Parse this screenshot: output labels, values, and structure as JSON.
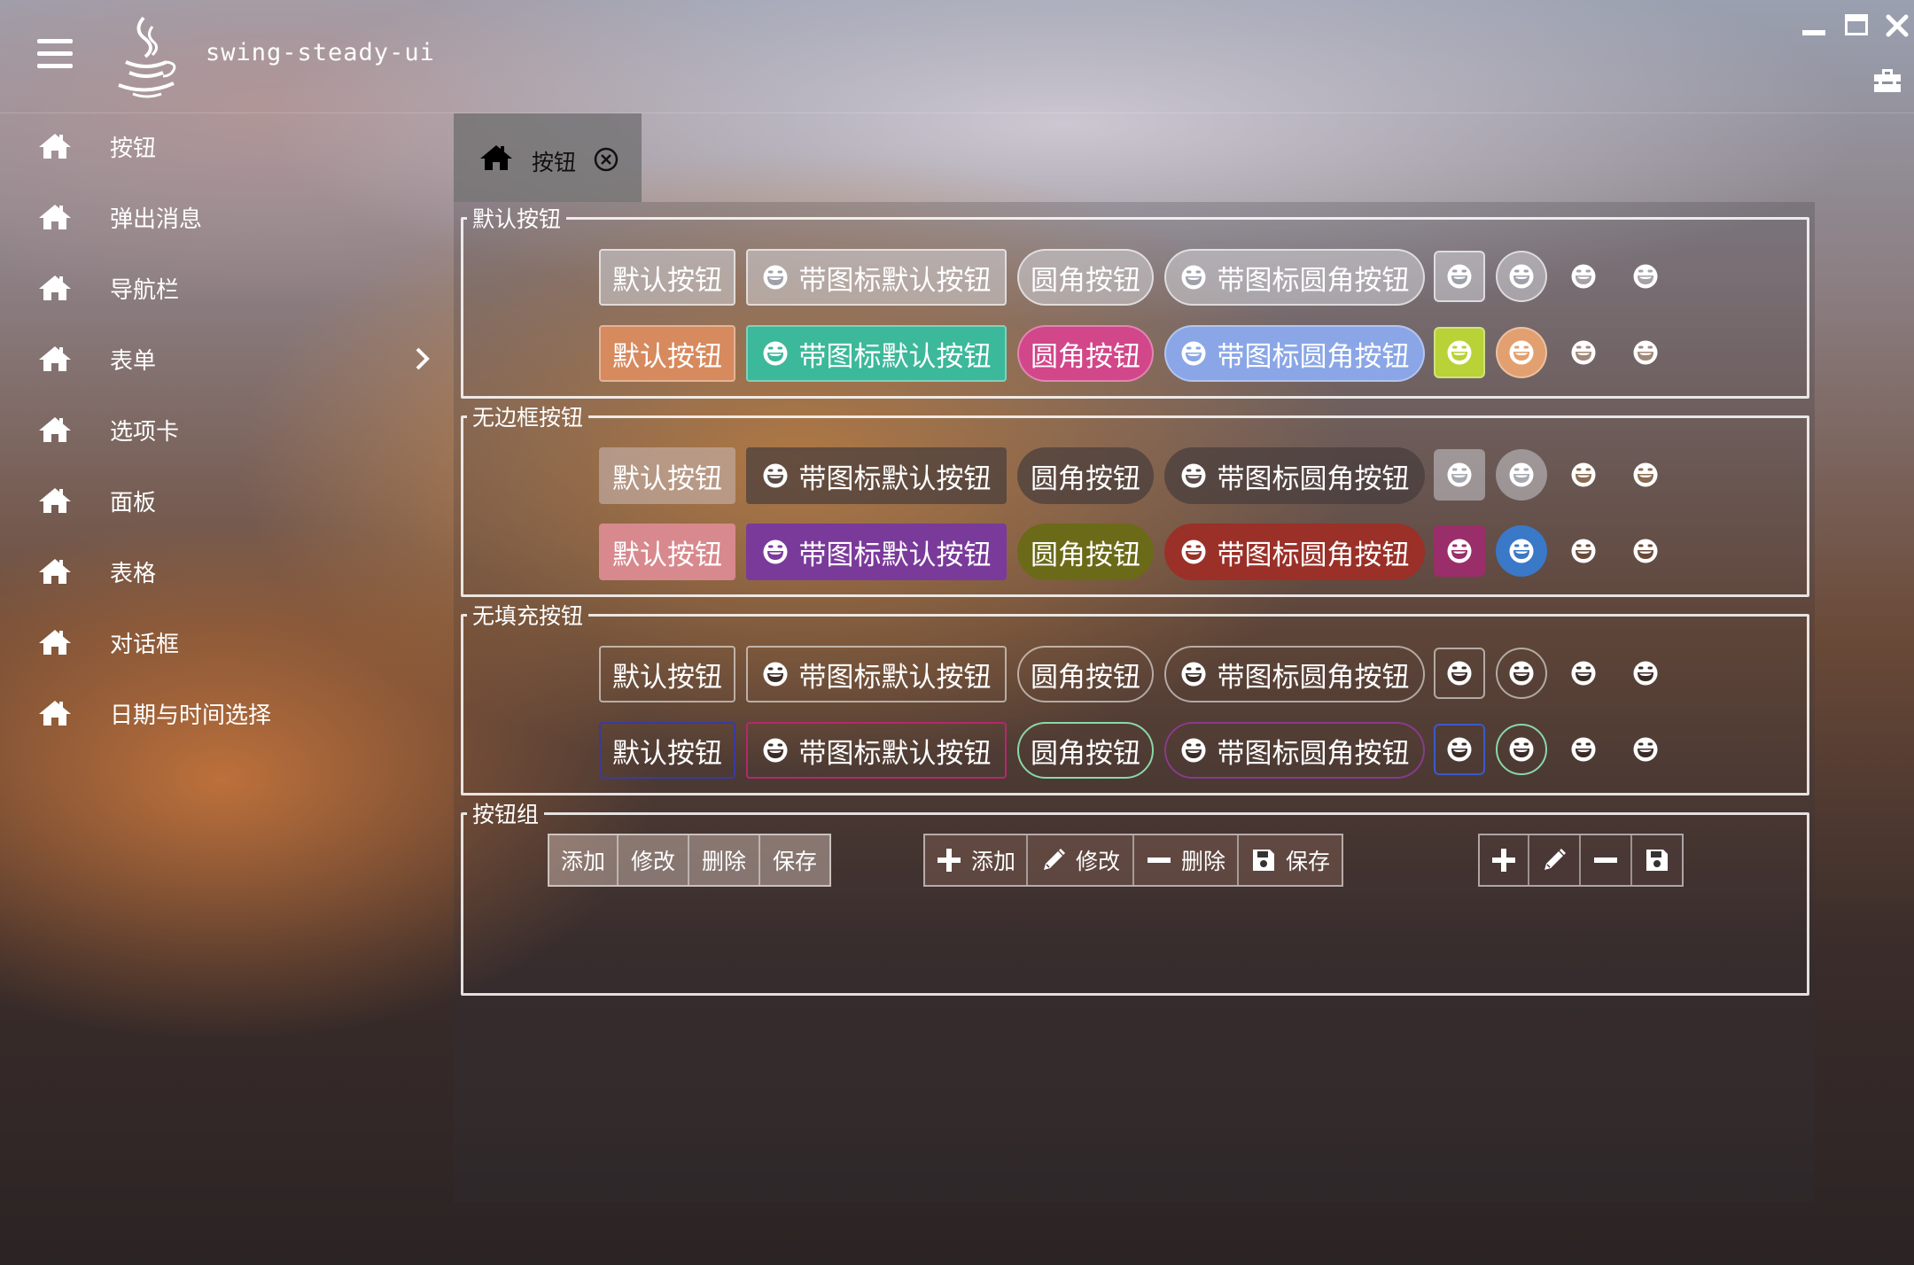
{
  "app": {
    "title": "swing-steady-ui"
  },
  "sidebar": {
    "items": [
      {
        "label": "按钮"
      },
      {
        "label": "弹出消息"
      },
      {
        "label": "导航栏"
      },
      {
        "label": "表单"
      },
      {
        "label": "选项卡"
      },
      {
        "label": "面板"
      },
      {
        "label": "表格"
      },
      {
        "label": "对话框"
      },
      {
        "label": "日期与时间选择"
      }
    ]
  },
  "tabs": [
    {
      "label": "按钮"
    }
  ],
  "sections": {
    "default": {
      "title": "默认按钮"
    },
    "borderless": {
      "title": "无边框按钮"
    },
    "nofill": {
      "title": "无填充按钮"
    },
    "group": {
      "title": "按钮组"
    }
  },
  "buttons": {
    "default": "默认按钮",
    "icon_default": "带图标默认按钮",
    "round": "圆角按钮",
    "icon_round": "带图标圆角按钮"
  },
  "button_group": {
    "add": "添加",
    "edit": "修改",
    "delete": "删除",
    "save": "保存"
  },
  "colors": {
    "default_row2": [
      "#d78a5e",
      "#3cb89a",
      "#d2468a",
      "#8aa6e6",
      "#b8d238",
      "#e2a070"
    ],
    "borderless_row2": [
      "#d8898e",
      "#7a3a9a",
      "#6b6a18",
      "#9a3028",
      "#9a2e6a",
      "#3a78c8"
    ],
    "nofill_row2_borders": [
      "#3a3aa0",
      "#b4286a",
      "#8ad8a8",
      "#8a3a8a",
      "#3a5ac8",
      "#8ad8a8"
    ]
  },
  "icons": [
    "menu-icon",
    "java-logo-icon",
    "minimize-icon",
    "maximize-icon",
    "close-icon",
    "toolbox-icon",
    "home-icon",
    "chevron-right-icon",
    "close-circle-icon",
    "smile-icon",
    "plus-icon",
    "pencil-icon",
    "minus-icon",
    "save-icon"
  ]
}
